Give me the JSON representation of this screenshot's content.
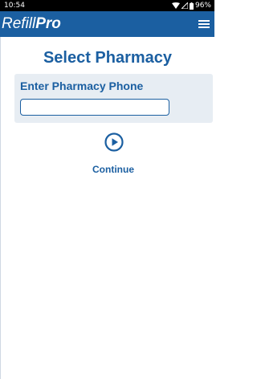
{
  "status_bar": {
    "time": "10:54",
    "battery": "96%",
    "icons": [
      "wifi-icon",
      "cellular-signal-icon",
      "battery-icon"
    ]
  },
  "app_bar": {
    "brand_light": "Refill",
    "brand_bold": "Pro",
    "menu_icon": "hamburger-menu-icon",
    "color": "#1b5fa1"
  },
  "page": {
    "title": "Select Pharmacy"
  },
  "phone_form": {
    "label": "Enter Pharmacy Phone",
    "value": "",
    "placeholder": ""
  },
  "continue_button": {
    "label": "Continue",
    "icon": "play-circle-icon"
  },
  "colors": {
    "accent": "#1b5fa1",
    "panel_background": "#e7edf3",
    "status_bar": "#000000"
  }
}
